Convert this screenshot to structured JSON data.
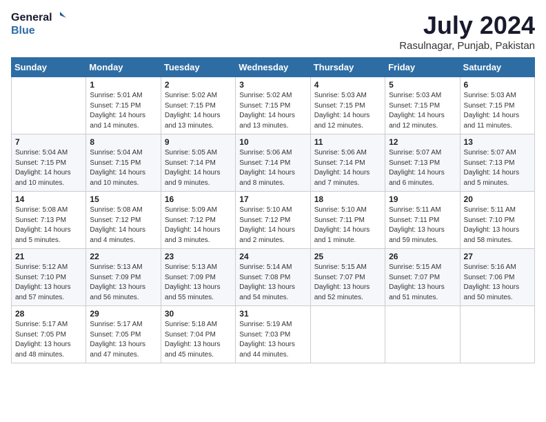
{
  "header": {
    "logo_line1": "General",
    "logo_line2": "Blue",
    "title": "July 2024",
    "subtitle": "Rasulnagar, Punjab, Pakistan"
  },
  "weekdays": [
    "Sunday",
    "Monday",
    "Tuesday",
    "Wednesday",
    "Thursday",
    "Friday",
    "Saturday"
  ],
  "weeks": [
    [
      {
        "day": "",
        "sunrise": "",
        "sunset": "",
        "daylight": ""
      },
      {
        "day": "1",
        "sunrise": "Sunrise: 5:01 AM",
        "sunset": "Sunset: 7:15 PM",
        "daylight": "Daylight: 14 hours and 14 minutes."
      },
      {
        "day": "2",
        "sunrise": "Sunrise: 5:02 AM",
        "sunset": "Sunset: 7:15 PM",
        "daylight": "Daylight: 14 hours and 13 minutes."
      },
      {
        "day": "3",
        "sunrise": "Sunrise: 5:02 AM",
        "sunset": "Sunset: 7:15 PM",
        "daylight": "Daylight: 14 hours and 13 minutes."
      },
      {
        "day": "4",
        "sunrise": "Sunrise: 5:03 AM",
        "sunset": "Sunset: 7:15 PM",
        "daylight": "Daylight: 14 hours and 12 minutes."
      },
      {
        "day": "5",
        "sunrise": "Sunrise: 5:03 AM",
        "sunset": "Sunset: 7:15 PM",
        "daylight": "Daylight: 14 hours and 12 minutes."
      },
      {
        "day": "6",
        "sunrise": "Sunrise: 5:03 AM",
        "sunset": "Sunset: 7:15 PM",
        "daylight": "Daylight: 14 hours and 11 minutes."
      }
    ],
    [
      {
        "day": "7",
        "sunrise": "Sunrise: 5:04 AM",
        "sunset": "Sunset: 7:15 PM",
        "daylight": "Daylight: 14 hours and 10 minutes."
      },
      {
        "day": "8",
        "sunrise": "Sunrise: 5:04 AM",
        "sunset": "Sunset: 7:15 PM",
        "daylight": "Daylight: 14 hours and 10 minutes."
      },
      {
        "day": "9",
        "sunrise": "Sunrise: 5:05 AM",
        "sunset": "Sunset: 7:14 PM",
        "daylight": "Daylight: 14 hours and 9 minutes."
      },
      {
        "day": "10",
        "sunrise": "Sunrise: 5:06 AM",
        "sunset": "Sunset: 7:14 PM",
        "daylight": "Daylight: 14 hours and 8 minutes."
      },
      {
        "day": "11",
        "sunrise": "Sunrise: 5:06 AM",
        "sunset": "Sunset: 7:14 PM",
        "daylight": "Daylight: 14 hours and 7 minutes."
      },
      {
        "day": "12",
        "sunrise": "Sunrise: 5:07 AM",
        "sunset": "Sunset: 7:13 PM",
        "daylight": "Daylight: 14 hours and 6 minutes."
      },
      {
        "day": "13",
        "sunrise": "Sunrise: 5:07 AM",
        "sunset": "Sunset: 7:13 PM",
        "daylight": "Daylight: 14 hours and 5 minutes."
      }
    ],
    [
      {
        "day": "14",
        "sunrise": "Sunrise: 5:08 AM",
        "sunset": "Sunset: 7:13 PM",
        "daylight": "Daylight: 14 hours and 5 minutes."
      },
      {
        "day": "15",
        "sunrise": "Sunrise: 5:08 AM",
        "sunset": "Sunset: 7:12 PM",
        "daylight": "Daylight: 14 hours and 4 minutes."
      },
      {
        "day": "16",
        "sunrise": "Sunrise: 5:09 AM",
        "sunset": "Sunset: 7:12 PM",
        "daylight": "Daylight: 14 hours and 3 minutes."
      },
      {
        "day": "17",
        "sunrise": "Sunrise: 5:10 AM",
        "sunset": "Sunset: 7:12 PM",
        "daylight": "Daylight: 14 hours and 2 minutes."
      },
      {
        "day": "18",
        "sunrise": "Sunrise: 5:10 AM",
        "sunset": "Sunset: 7:11 PM",
        "daylight": "Daylight: 14 hours and 1 minute."
      },
      {
        "day": "19",
        "sunrise": "Sunrise: 5:11 AM",
        "sunset": "Sunset: 7:11 PM",
        "daylight": "Daylight: 13 hours and 59 minutes."
      },
      {
        "day": "20",
        "sunrise": "Sunrise: 5:11 AM",
        "sunset": "Sunset: 7:10 PM",
        "daylight": "Daylight: 13 hours and 58 minutes."
      }
    ],
    [
      {
        "day": "21",
        "sunrise": "Sunrise: 5:12 AM",
        "sunset": "Sunset: 7:10 PM",
        "daylight": "Daylight: 13 hours and 57 minutes."
      },
      {
        "day": "22",
        "sunrise": "Sunrise: 5:13 AM",
        "sunset": "Sunset: 7:09 PM",
        "daylight": "Daylight: 13 hours and 56 minutes."
      },
      {
        "day": "23",
        "sunrise": "Sunrise: 5:13 AM",
        "sunset": "Sunset: 7:09 PM",
        "daylight": "Daylight: 13 hours and 55 minutes."
      },
      {
        "day": "24",
        "sunrise": "Sunrise: 5:14 AM",
        "sunset": "Sunset: 7:08 PM",
        "daylight": "Daylight: 13 hours and 54 minutes."
      },
      {
        "day": "25",
        "sunrise": "Sunrise: 5:15 AM",
        "sunset": "Sunset: 7:07 PM",
        "daylight": "Daylight: 13 hours and 52 minutes."
      },
      {
        "day": "26",
        "sunrise": "Sunrise: 5:15 AM",
        "sunset": "Sunset: 7:07 PM",
        "daylight": "Daylight: 13 hours and 51 minutes."
      },
      {
        "day": "27",
        "sunrise": "Sunrise: 5:16 AM",
        "sunset": "Sunset: 7:06 PM",
        "daylight": "Daylight: 13 hours and 50 minutes."
      }
    ],
    [
      {
        "day": "28",
        "sunrise": "Sunrise: 5:17 AM",
        "sunset": "Sunset: 7:05 PM",
        "daylight": "Daylight: 13 hours and 48 minutes."
      },
      {
        "day": "29",
        "sunrise": "Sunrise: 5:17 AM",
        "sunset": "Sunset: 7:05 PM",
        "daylight": "Daylight: 13 hours and 47 minutes."
      },
      {
        "day": "30",
        "sunrise": "Sunrise: 5:18 AM",
        "sunset": "Sunset: 7:04 PM",
        "daylight": "Daylight: 13 hours and 45 minutes."
      },
      {
        "day": "31",
        "sunrise": "Sunrise: 5:19 AM",
        "sunset": "Sunset: 7:03 PM",
        "daylight": "Daylight: 13 hours and 44 minutes."
      },
      {
        "day": "",
        "sunrise": "",
        "sunset": "",
        "daylight": ""
      },
      {
        "day": "",
        "sunrise": "",
        "sunset": "",
        "daylight": ""
      },
      {
        "day": "",
        "sunrise": "",
        "sunset": "",
        "daylight": ""
      }
    ]
  ]
}
